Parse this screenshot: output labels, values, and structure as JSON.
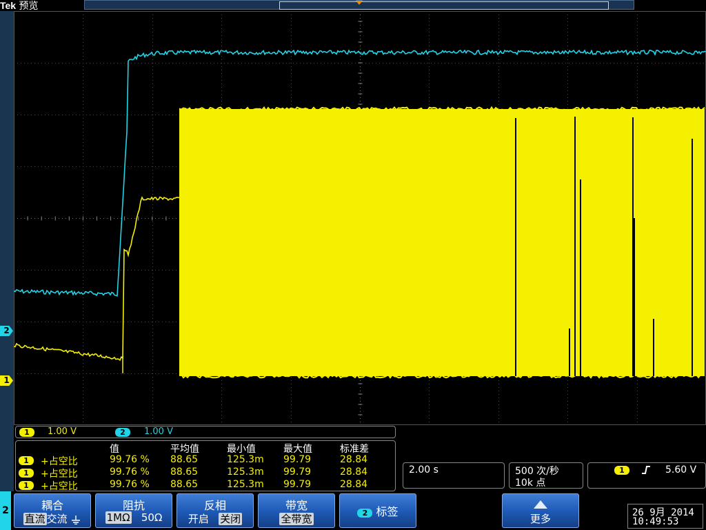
{
  "header": {
    "brand": "Tek",
    "mode": "预览"
  },
  "channels": [
    {
      "id": "1",
      "color": "#f5f000",
      "scale": "1.00 V"
    },
    {
      "id": "2",
      "color": "#21d4e8",
      "scale": "1.00 V"
    }
  ],
  "measurements": {
    "headers": [
      "值",
      "平均值",
      "最小值",
      "最大值",
      "标准差"
    ],
    "rows": [
      {
        "channel": "1",
        "name": "+占空比",
        "value": "99.76 %",
        "mean": "88.65",
        "min": "125.3m",
        "max": "99.79",
        "std": "28.84"
      },
      {
        "channel": "1",
        "name": "+占空比",
        "value": "99.76 %",
        "mean": "88.65",
        "min": "125.3m",
        "max": "99.79",
        "std": "28.84"
      },
      {
        "channel": "1",
        "name": "+占空比",
        "value": "99.76 %",
        "mean": "88.65",
        "min": "125.3m",
        "max": "99.79",
        "std": "28.84"
      }
    ]
  },
  "timebase": "2.00 s",
  "acquisition": {
    "rate": "500 次/秒",
    "points": "10k 点"
  },
  "trigger": {
    "channel": "1",
    "level": "5.60 V",
    "slope_icon": "rising-edge-icon"
  },
  "bottom_menu": {
    "channel_tab": "2",
    "coupling": {
      "title": "耦合",
      "options": [
        "直流",
        "交流"
      ],
      "selected": "直流"
    },
    "impedance": {
      "title": "阻抗",
      "options": [
        "1MΩ",
        "50Ω"
      ],
      "selected": "1MΩ"
    },
    "invert": {
      "title": "反相",
      "options": [
        "开启",
        "关闭"
      ],
      "selected": "关闭"
    },
    "bandwidth": {
      "title": "带宽",
      "value": "全带宽"
    },
    "label": {
      "chip": "2",
      "title": "标签"
    },
    "more": {
      "title": "更多"
    }
  },
  "datetime": {
    "date": "26 9月 2014",
    "time": "10:49:53"
  }
}
